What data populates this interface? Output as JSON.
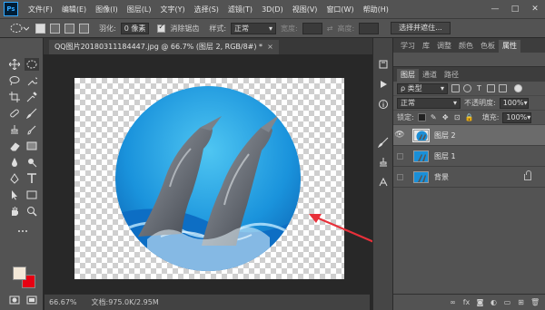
{
  "menu": {
    "logo": "Ps",
    "items": [
      "文件(F)",
      "编辑(E)",
      "图像(I)",
      "图层(L)",
      "文字(Y)",
      "选择(S)",
      "滤镜(T)",
      "3D(D)",
      "视图(V)",
      "窗口(W)",
      "帮助(H)"
    ],
    "win": [
      "—",
      "□",
      "✕"
    ]
  },
  "options": {
    "feather_label": "羽化:",
    "feather_value": "0 像素",
    "antialias_label": "消除锯齿",
    "style_label": "样式:",
    "style_value": "正常",
    "width_label": "宽度:",
    "height_label": "高度:",
    "select_mask_btn": "选择并遮住..."
  },
  "document": {
    "tab_title": "QQ图片20180311184447.jpg @ 66.7% (图层 2, RGB/8#) *",
    "tab_close": "×"
  },
  "status": {
    "zoom": "66.67%",
    "doc_info": "文档:975.0K/2.95M"
  },
  "properties_tabs": [
    "学习",
    "库",
    "调整",
    "颜色",
    "色板",
    "属性"
  ],
  "layers_panel": {
    "tabs": [
      "图层",
      "通道",
      "路径"
    ],
    "filter_label": "ρ 类型",
    "blend_mode": "正常",
    "opacity_label": "不透明度:",
    "opacity_value": "100%",
    "lock_label": "锁定:",
    "fill_label": "填充:",
    "fill_value": "100%",
    "layers": [
      {
        "name": "图层 2",
        "visible": true,
        "active": true
      },
      {
        "name": "图层 1",
        "visible": false,
        "active": false
      },
      {
        "name": "背景",
        "visible": false,
        "active": false,
        "locked": true
      }
    ],
    "footer_icons": [
      "link-icon",
      "fx-icon",
      "mask-icon",
      "adjustment-icon",
      "group-icon",
      "new-layer-icon",
      "trash-icon"
    ]
  },
  "colors": {
    "foreground": "#f3e8d8",
    "background": "#e60012",
    "annotation_arrow": "#e8303a"
  }
}
